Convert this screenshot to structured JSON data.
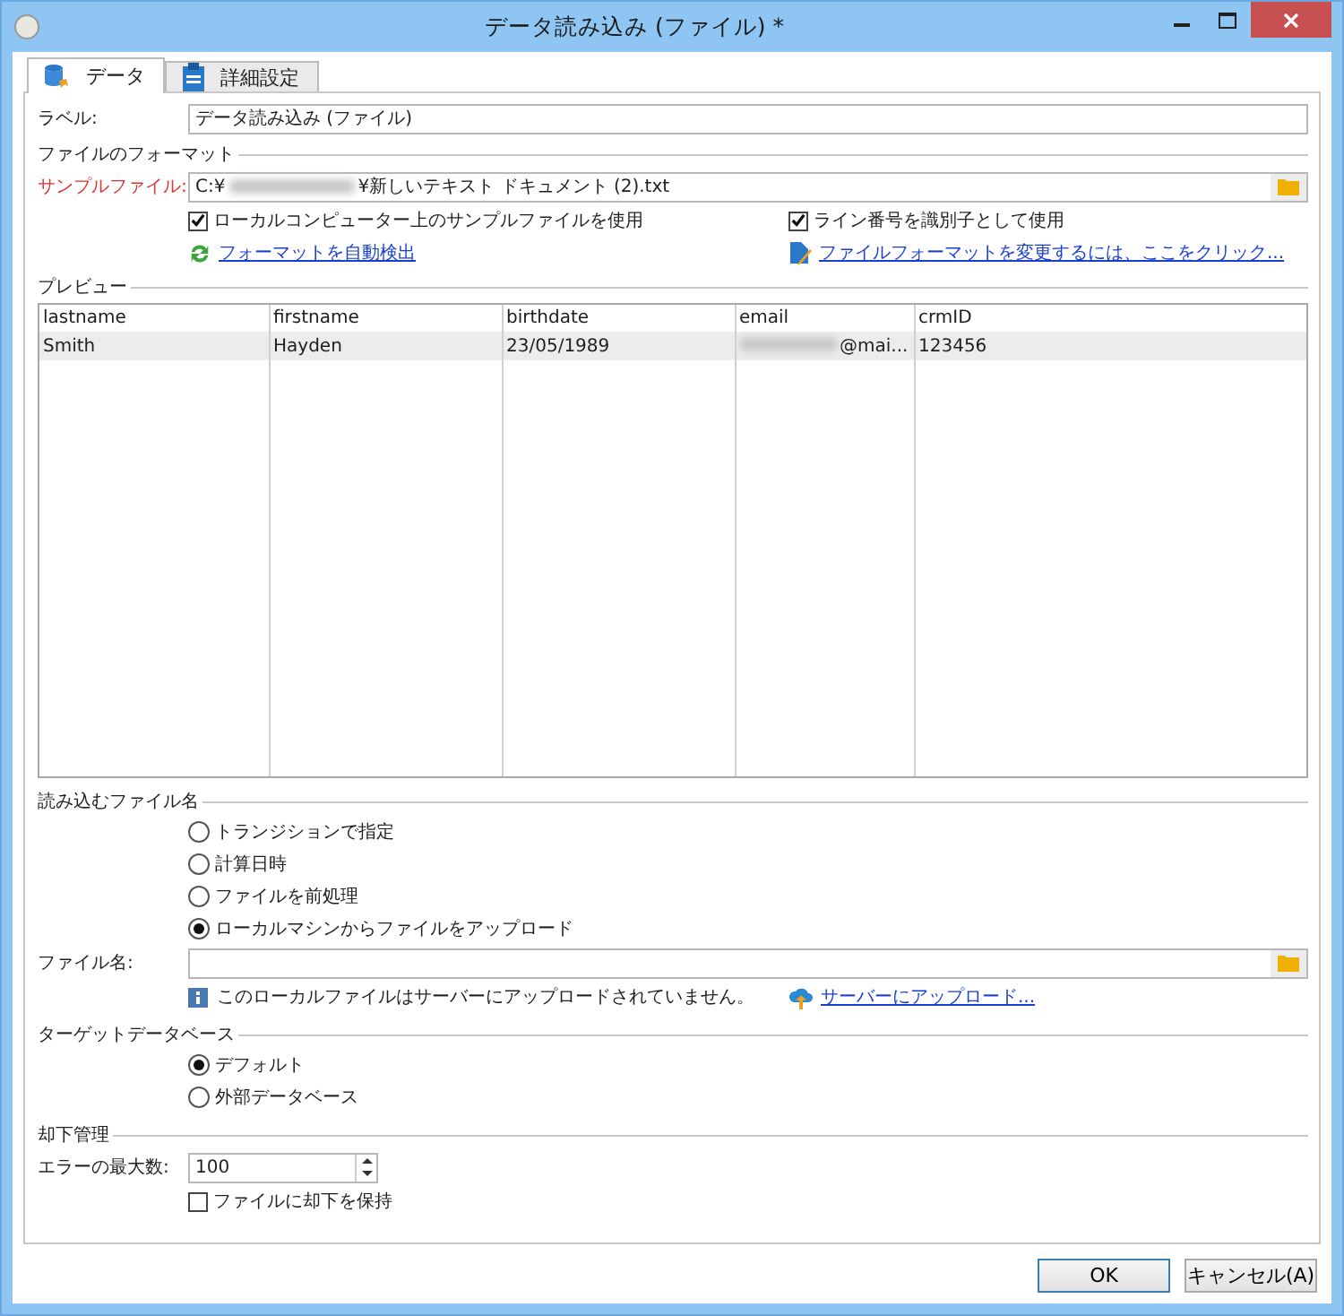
{
  "window": {
    "title": "データ読み込み (ファイル) *"
  },
  "tabs": [
    {
      "label": "データ",
      "selected": true,
      "kind": "database"
    },
    {
      "label": "詳細設定",
      "selected": false,
      "kind": "clipboard"
    }
  ],
  "label_field": {
    "label": "ラベル:",
    "value": "データ読み込み (ファイル)"
  },
  "file_format": {
    "title": "ファイルのフォーマット",
    "sample_file": {
      "label": "サンプルファイル:",
      "value_start": "C:¥",
      "value_end": "¥新しいテキスト ドキュメント (2).txt"
    },
    "options": [
      {
        "label": "ローカルコンピューター上のサンプルファイルを使用",
        "checked": true
      },
      {
        "label": "ライン番号を識別子として使用",
        "checked": true
      }
    ],
    "links": [
      {
        "label": "フォーマットを自動検出",
        "kind": "refresh"
      },
      {
        "label": "ファイルフォーマットを変更するには、ここをクリック...",
        "kind": "edit"
      }
    ]
  },
  "preview": {
    "title": "プレビュー",
    "columns": [
      "lastname",
      "firstname",
      "birthdate",
      "email",
      "crmID"
    ],
    "rows": [
      {
        "selected": true,
        "cells": [
          "Smith",
          "Hayden",
          "23/05/1989",
          "@mai...",
          "123456"
        ]
      }
    ]
  },
  "file_name": {
    "title": "読み込むファイル名",
    "options": [
      {
        "label": "トランジションで指定",
        "selected": false
      },
      {
        "label": "計算日時",
        "selected": false
      },
      {
        "label": "ファイルを前処理",
        "selected": false
      },
      {
        "label": "ローカルマシンからファイルをアップロード",
        "selected": true
      }
    ],
    "field_label": "ファイル名:",
    "info": "このローカルファイルはサーバーにアップロードされていません。",
    "upload_link": "サーバーにアップロード..."
  },
  "target_database": {
    "title": "ターゲットデータベース",
    "options": [
      {
        "label": "デフォルト",
        "selected": true
      },
      {
        "label": "外部データベース",
        "selected": false
      }
    ]
  },
  "rejects": {
    "title": "却下管理",
    "max_errors_label": "エラーの最大数:",
    "max_errors_value": "100",
    "keep_option": {
      "label": "ファイルに却下を保持",
      "checked": false
    }
  },
  "buttons": [
    "OK",
    "キャンセル(A)"
  ]
}
